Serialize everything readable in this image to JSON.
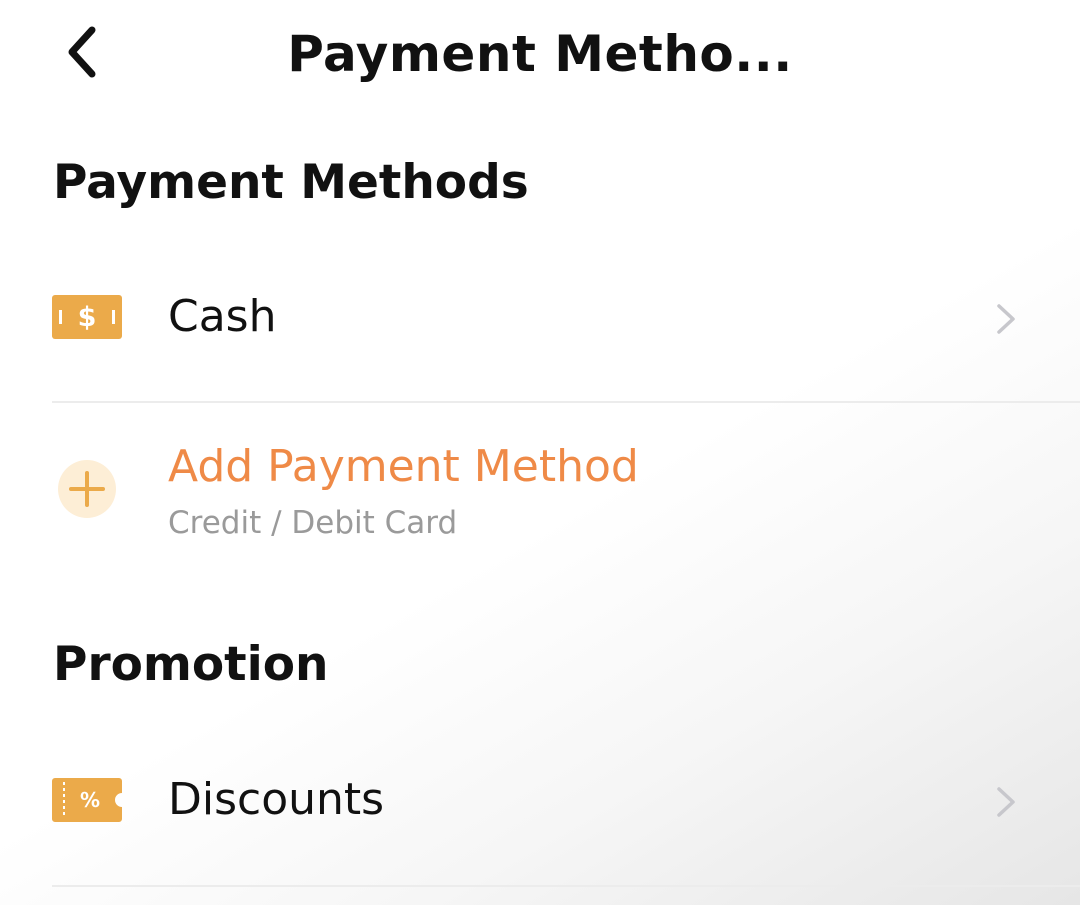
{
  "header": {
    "title": "Payment Metho...",
    "back_icon": "chevron-left-icon"
  },
  "payment_methods": {
    "section_title": "Payment Methods",
    "cash": {
      "label": "Cash",
      "icon": "cash-icon",
      "icon_text": "$"
    },
    "add_method": {
      "label": "Add Payment Method",
      "sublabel": "Credit / Debit Card",
      "icon": "plus-icon"
    }
  },
  "promotion": {
    "section_title": "Promotion",
    "discounts": {
      "label": "Discounts",
      "icon": "discount-ticket-icon",
      "icon_text": "%"
    }
  },
  "colors": {
    "accent_orange": "#ef8a47",
    "icon_gold": "#ebaa4a",
    "plus_circle_bg": "#fdeed6",
    "secondary_text": "#9a9a9a",
    "chevron_gray": "#c7c7cc",
    "divider": "#ececec"
  }
}
